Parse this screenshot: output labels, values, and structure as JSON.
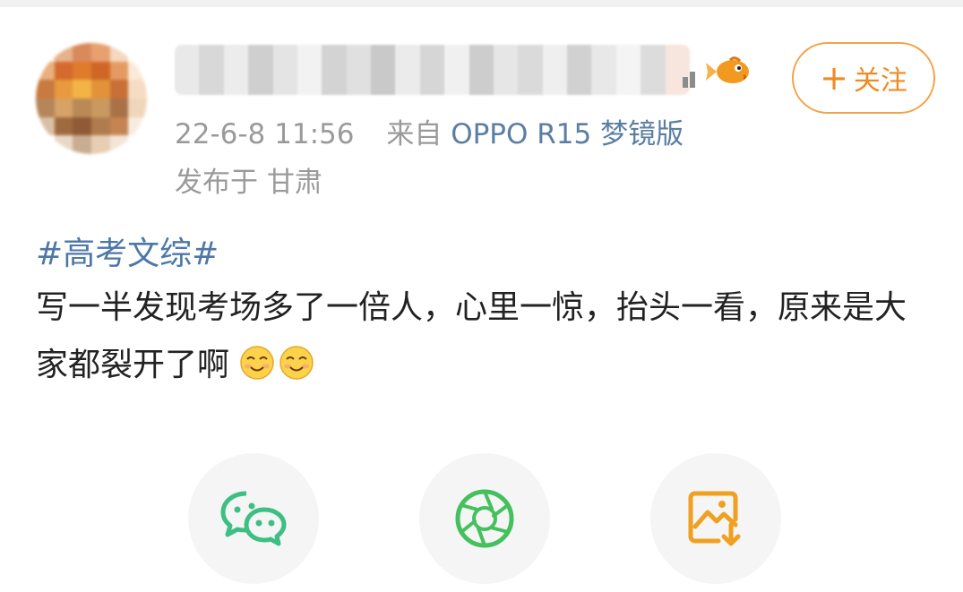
{
  "post": {
    "follow_label": "关注",
    "follow_plus": "+",
    "time": "22-6-8 11:56",
    "source_prefix": "来自",
    "device": "OPPO R15 梦镜版",
    "location": "发布于 甘肃",
    "hashtag": "#高考文综#",
    "text": "写一半发现考场多了一倍人，心里一惊，抬头一看，原来是大家都裂开了啊"
  },
  "share_actions": [
    {
      "icon": "wechat-icon",
      "color": "#3dbf83"
    },
    {
      "icon": "moments-icon",
      "color": "#44c05c"
    },
    {
      "icon": "save-image-icon",
      "color": "#f0a020"
    }
  ]
}
